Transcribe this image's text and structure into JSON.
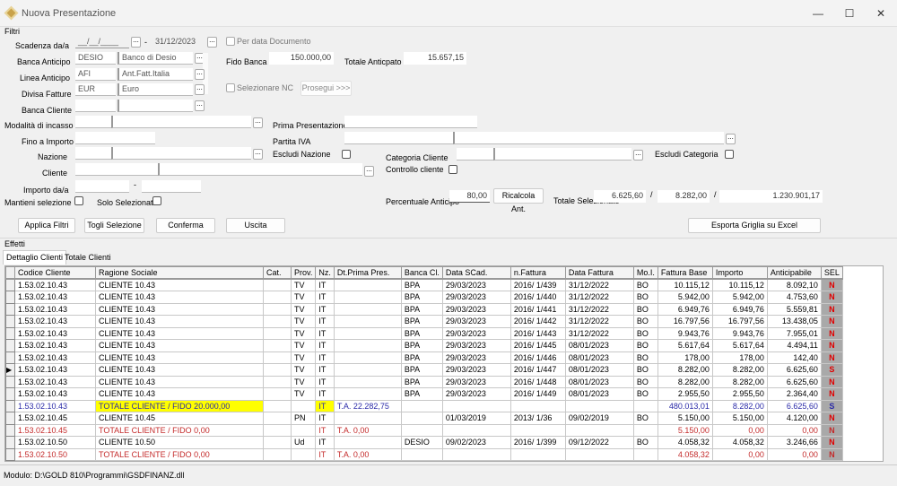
{
  "window": {
    "title": "Nuova Presentazione",
    "minimize": "—",
    "maximize": "☐",
    "close": "✕"
  },
  "filtri": {
    "section": "Filtri",
    "scadenza": {
      "label": "Scadenza da/a",
      "from": "__/__/____",
      "to": "31/12/2023",
      "per_data_doc": "Per data Documento"
    },
    "banca_anticipo": {
      "label": "Banca Anticipo",
      "code": "DESIO",
      "desc": "Banco di Desio"
    },
    "linea_anticipo": {
      "label": "Linea Anticipo",
      "code": "AFI",
      "desc": "Ant.Fatt.Italia"
    },
    "divisa": {
      "label": "Divisa Fatture",
      "code": "EUR",
      "desc": "Euro"
    },
    "banca_cliente": {
      "label": "Banca Cliente"
    },
    "fido_banca": {
      "label": "Fido Banca",
      "value": "150.000,00"
    },
    "totale_anticipato": {
      "label": "Totale Anticpato",
      "value": "15.657,15"
    },
    "selezionare_nc": "Selezionare NC",
    "prosegui": "Prosegui >>>",
    "modalita": {
      "label": "Modalità di incasso"
    },
    "prima_presentazione": {
      "label": "Prima Presentazione"
    },
    "fino_importo": {
      "label": "Fino a Importo"
    },
    "partita_iva": {
      "label": "Partita IVA"
    },
    "nazione": {
      "label": "Nazione"
    },
    "escludi_nazione": "Escludi Nazione",
    "categoria_cliente": {
      "label": "Categoria Cliente"
    },
    "escludi_categoria": "Escludi Categoria",
    "cliente": {
      "label": "Cliente"
    },
    "controllo_cliente": "Controllo cliente",
    "importo": {
      "label": "Importo da/a",
      "sep": "-"
    },
    "mantieni": "Mantieni selezione",
    "solo_selezionati": "Solo Selezionati",
    "percentuale": {
      "label": "Percentuale Anticipo",
      "value": "80,00"
    },
    "ricalcola": "Ricalcola Ant.",
    "totale_selezionato": {
      "label": "Totale Selezionato",
      "v1": "6.625,60",
      "v2": "8.282,00",
      "v3": "1.230.901,17",
      "sep": "/"
    }
  },
  "buttons": {
    "applica": "Applica Filtri",
    "togli": "Togli Selezione",
    "conferma": "Conferma",
    "uscita": "Uscita",
    "esporta": "Esporta Griglia su Excel"
  },
  "effetti": {
    "section": "Effetti",
    "tabs": [
      "Dettaglio Clienti",
      "Totale Clienti"
    ]
  },
  "grid": {
    "columns": [
      "Codice Cliente",
      "Ragione Sociale",
      "Cat.",
      "Prov.",
      "Nz.",
      "Dt.Prima Pres.",
      "Banca Cl.",
      "Data SCad.",
      "n.Fattura",
      "Data Fattura",
      "Mo.I.",
      "Fattura Base",
      "Importo",
      "Anticipabile",
      "SEL"
    ],
    "rows": [
      {
        "type": "normal",
        "cells": [
          "1.53.02.10.43",
          "CLIENTE 10.43",
          "",
          "TV",
          "IT",
          "",
          "BPA",
          "29/03/2023",
          "2016/ 1/439",
          "31/12/2022",
          "BO",
          "10.115,12",
          "10.115,12",
          "8.092,10",
          "N"
        ]
      },
      {
        "type": "normal",
        "cells": [
          "1.53.02.10.43",
          "CLIENTE 10.43",
          "",
          "TV",
          "IT",
          "",
          "BPA",
          "29/03/2023",
          "2016/ 1/440",
          "31/12/2022",
          "BO",
          "5.942,00",
          "5.942,00",
          "4.753,60",
          "N"
        ]
      },
      {
        "type": "normal",
        "cells": [
          "1.53.02.10.43",
          "CLIENTE 10.43",
          "",
          "TV",
          "IT",
          "",
          "BPA",
          "29/03/2023",
          "2016/ 1/441",
          "31/12/2022",
          "BO",
          "6.949,76",
          "6.949,76",
          "5.559,81",
          "N"
        ]
      },
      {
        "type": "normal",
        "cells": [
          "1.53.02.10.43",
          "CLIENTE 10.43",
          "",
          "TV",
          "IT",
          "",
          "BPA",
          "29/03/2023",
          "2016/ 1/442",
          "31/12/2022",
          "BO",
          "16.797,56",
          "16.797,56",
          "13.438,05",
          "N"
        ]
      },
      {
        "type": "normal",
        "cells": [
          "1.53.02.10.43",
          "CLIENTE 10.43",
          "",
          "TV",
          "IT",
          "",
          "BPA",
          "29/03/2023",
          "2016/ 1/443",
          "31/12/2022",
          "BO",
          "9.943,76",
          "9.943,76",
          "7.955,01",
          "N"
        ]
      },
      {
        "type": "normal",
        "cells": [
          "1.53.02.10.43",
          "CLIENTE 10.43",
          "",
          "TV",
          "IT",
          "",
          "BPA",
          "29/03/2023",
          "2016/ 1/445",
          "08/01/2023",
          "BO",
          "5.617,64",
          "5.617,64",
          "4.494,11",
          "N"
        ]
      },
      {
        "type": "normal",
        "cells": [
          "1.53.02.10.43",
          "CLIENTE 10.43",
          "",
          "TV",
          "IT",
          "",
          "BPA",
          "29/03/2023",
          "2016/ 1/446",
          "08/01/2023",
          "BO",
          "178,00",
          "178,00",
          "142,40",
          "N"
        ]
      },
      {
        "type": "normal",
        "current": true,
        "cells": [
          "1.53.02.10.43",
          "CLIENTE 10.43",
          "",
          "TV",
          "IT",
          "",
          "BPA",
          "29/03/2023",
          "2016/ 1/447",
          "08/01/2023",
          "BO",
          "8.282,00",
          "8.282,00",
          "6.625,60",
          "S"
        ]
      },
      {
        "type": "normal",
        "cells": [
          "1.53.02.10.43",
          "CLIENTE 10.43",
          "",
          "TV",
          "IT",
          "",
          "BPA",
          "29/03/2023",
          "2016/ 1/448",
          "08/01/2023",
          "BO",
          "8.282,00",
          "8.282,00",
          "6.625,60",
          "N"
        ]
      },
      {
        "type": "normal",
        "cells": [
          "1.53.02.10.43",
          "CLIENTE 10.43",
          "",
          "TV",
          "IT",
          "",
          "BPA",
          "29/03/2023",
          "2016/ 1/449",
          "08/01/2023",
          "BO",
          "2.955,50",
          "2.955,50",
          "2.364,40",
          "N"
        ]
      },
      {
        "type": "blue",
        "highlight": "#ffff00",
        "cells": [
          "1.53.02.10.43",
          "TOTALE CLIENTE / FIDO 20.000,00",
          "",
          "",
          "IT",
          "T.A. 22.282,75",
          "",
          "",
          "",
          "",
          "",
          "480.013,01",
          "8.282,00",
          "6.625,60",
          "S"
        ]
      },
      {
        "type": "normal",
        "cells": [
          "1.53.02.10.45",
          "CLIENTE 10.45",
          "",
          "PN",
          "IT",
          "",
          "",
          "01/03/2019",
          "2013/ 1/36",
          "09/02/2019",
          "BO",
          "5.150,00",
          "5.150,00",
          "4.120,00",
          "N"
        ]
      },
      {
        "type": "red",
        "cells": [
          "1.53.02.10.45",
          "TOTALE CLIENTE / FIDO 0,00",
          "",
          "",
          "IT",
          "T.A. 0,00",
          "",
          "",
          "",
          "",
          "",
          "5.150,00",
          "0,00",
          "0,00",
          "N"
        ]
      },
      {
        "type": "normal",
        "cells": [
          "1.53.02.10.50",
          "CLIENTE 10.50",
          "",
          "Ud",
          "IT",
          "",
          "DESIO",
          "09/02/2023",
          "2016/ 1/399",
          "09/12/2022",
          "BO",
          "4.058,32",
          "4.058,32",
          "3.246,66",
          "N"
        ]
      },
      {
        "type": "red",
        "cells": [
          "1.53.02.10.50",
          "TOTALE CLIENTE / FIDO 0,00",
          "",
          "",
          "IT",
          "T.A. 0,00",
          "",
          "",
          "",
          "",
          "",
          "4.058,32",
          "0,00",
          "0,00",
          "N"
        ]
      }
    ]
  },
  "status": "Modulo: D:\\GOLD 810\\Programmi\\GSDFINANZ.dll"
}
